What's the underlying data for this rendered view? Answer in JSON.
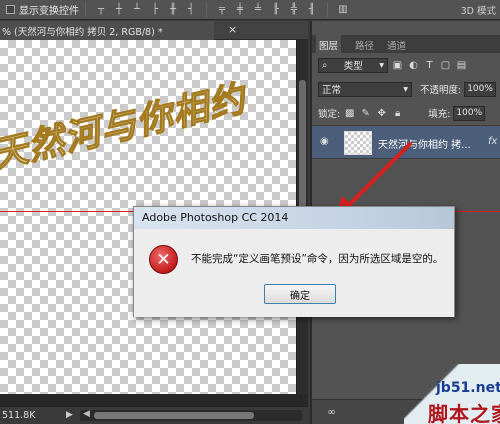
{
  "options_bar": {
    "show_transform_controls": "显示变换控件",
    "mode_3d": "3D 模式"
  },
  "document": {
    "tab_title": "% (天然河与你相约 拷贝 2, RGB/8) *",
    "close": "×",
    "canvas_art_text": "天然河与你相约",
    "status_size": "511.8K"
  },
  "layers_panel": {
    "tabs": [
      "图层",
      "路径",
      "通道"
    ],
    "filter_kind": "类型",
    "blend_mode": "正常",
    "opacity_label": "不透明度:",
    "opacity_value": "100%",
    "lock_label": "锁定:",
    "fill_label": "填充:",
    "fill_value": "100%",
    "layer_name": "天然河与你相约 拷...",
    "layer_fx": "fx"
  },
  "dialog": {
    "title": "Adobe Photoshop CC 2014",
    "message": "不能完成“定义画笔预设”命令，因为所选区域是空的。",
    "ok_label": "确定"
  },
  "watermark": {
    "site": "jb51.net",
    "name": "脚本之家"
  },
  "colors": {
    "guide_line": "#d81f1f",
    "arrow": "#d81f1f",
    "selected_layer": "#4b5f7a"
  }
}
